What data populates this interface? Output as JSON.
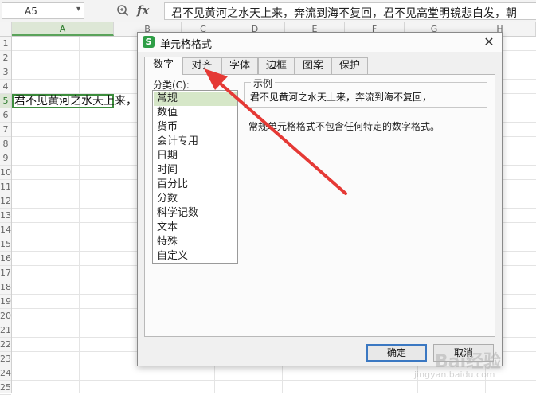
{
  "formula_bar": {
    "name_box": "A5",
    "content": "君不见黄河之水天上来，奔流到海不复回，君不见高堂明镜悲白发，朝"
  },
  "sheet": {
    "columns": [
      "A",
      "B",
      "C",
      "D",
      "E",
      "F",
      "G",
      "H"
    ],
    "rows": [
      "1",
      "2",
      "3",
      "4",
      "5",
      "6",
      "7",
      "8",
      "9",
      "10",
      "11",
      "12",
      "13",
      "14",
      "15",
      "16",
      "17",
      "18",
      "19",
      "20",
      "21",
      "22",
      "23",
      "24",
      "25"
    ],
    "active_cell_text": "君不见黄河之水天上来，",
    "active_column": "A",
    "active_row": "5"
  },
  "dialog": {
    "title": "单元格格式",
    "tabs": [
      "数字",
      "对齐",
      "字体",
      "边框",
      "图案",
      "保护"
    ],
    "selected_tab": "数字",
    "category_label": "分类(C):",
    "categories": [
      "常规",
      "数值",
      "货币",
      "会计专用",
      "日期",
      "时间",
      "百分比",
      "分数",
      "科学记数",
      "文本",
      "特殊",
      "自定义"
    ],
    "selected_category": "常规",
    "sample_label": "示例",
    "sample_text": "君不见黄河之水天上来，奔流到海不复回，",
    "description": "常规单元格格式不包含任何特定的数字格式。",
    "ok_label": "确定",
    "cancel_label": "取消"
  },
  "colors": {
    "accent_green": "#3c8d3c",
    "selection_green": "#d6e7c8",
    "annotation_red": "#e53935",
    "ok_border_blue": "#3b78c2"
  },
  "watermark": {
    "text": "Bai经验",
    "url": "jingyan.baidu.com"
  }
}
